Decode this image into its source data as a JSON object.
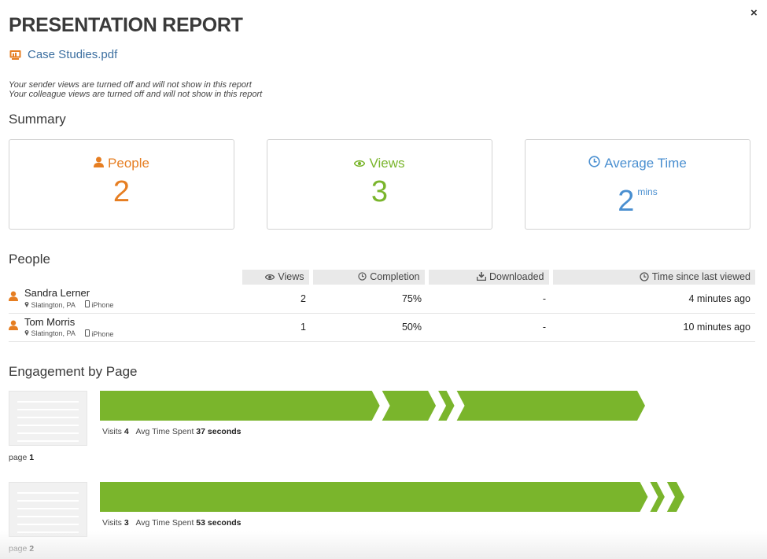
{
  "header": {
    "title": "PRESENTATION REPORT",
    "close": "×",
    "file_name": "Case Studies.pdf",
    "notes": [
      "Your sender views are turned off and will not show in this report",
      "Your colleague views are turned off and will not show in this report"
    ]
  },
  "summary": {
    "heading": "Summary",
    "cards": [
      {
        "label": "People",
        "value": "2",
        "unit": "",
        "color": "#e67e22",
        "icon": "person-icon"
      },
      {
        "label": "Views",
        "value": "3",
        "unit": "",
        "color": "#7ab52c",
        "icon": "eye-icon"
      },
      {
        "label": "Average Time",
        "value": "2",
        "unit": "mins",
        "color": "#4a8fd0",
        "icon": "clock-icon"
      }
    ]
  },
  "people": {
    "heading": "People",
    "columns": [
      "Views",
      "Completion",
      "Downloaded",
      "Time since last viewed"
    ],
    "rows": [
      {
        "name": "Sandra Lerner",
        "location": "Slatington, PA",
        "device": "iPhone",
        "views": "2",
        "completion": "75%",
        "downloaded": "-",
        "last_viewed": "4 minutes ago"
      },
      {
        "name": "Tom Morris",
        "location": "Slatington, PA",
        "device": "iPhone",
        "views": "1",
        "completion": "50%",
        "downloaded": "-",
        "last_viewed": "10 minutes ago"
      }
    ]
  },
  "engagement": {
    "heading": "Engagement by Page",
    "accent": "#7ab52c",
    "visits_label": "Visits",
    "time_label": "Avg Time Spent",
    "page_label": "page",
    "pages": [
      {
        "page": "1",
        "visits": "4",
        "avg_time": "37 seconds",
        "segment_fractions": [
          0.52,
          0.1,
          0.03,
          0.35
        ]
      },
      {
        "page": "2",
        "visits": "3",
        "avg_time": "53 seconds",
        "segment_fractions": [
          0.945,
          0.025,
          0.03
        ]
      }
    ]
  }
}
